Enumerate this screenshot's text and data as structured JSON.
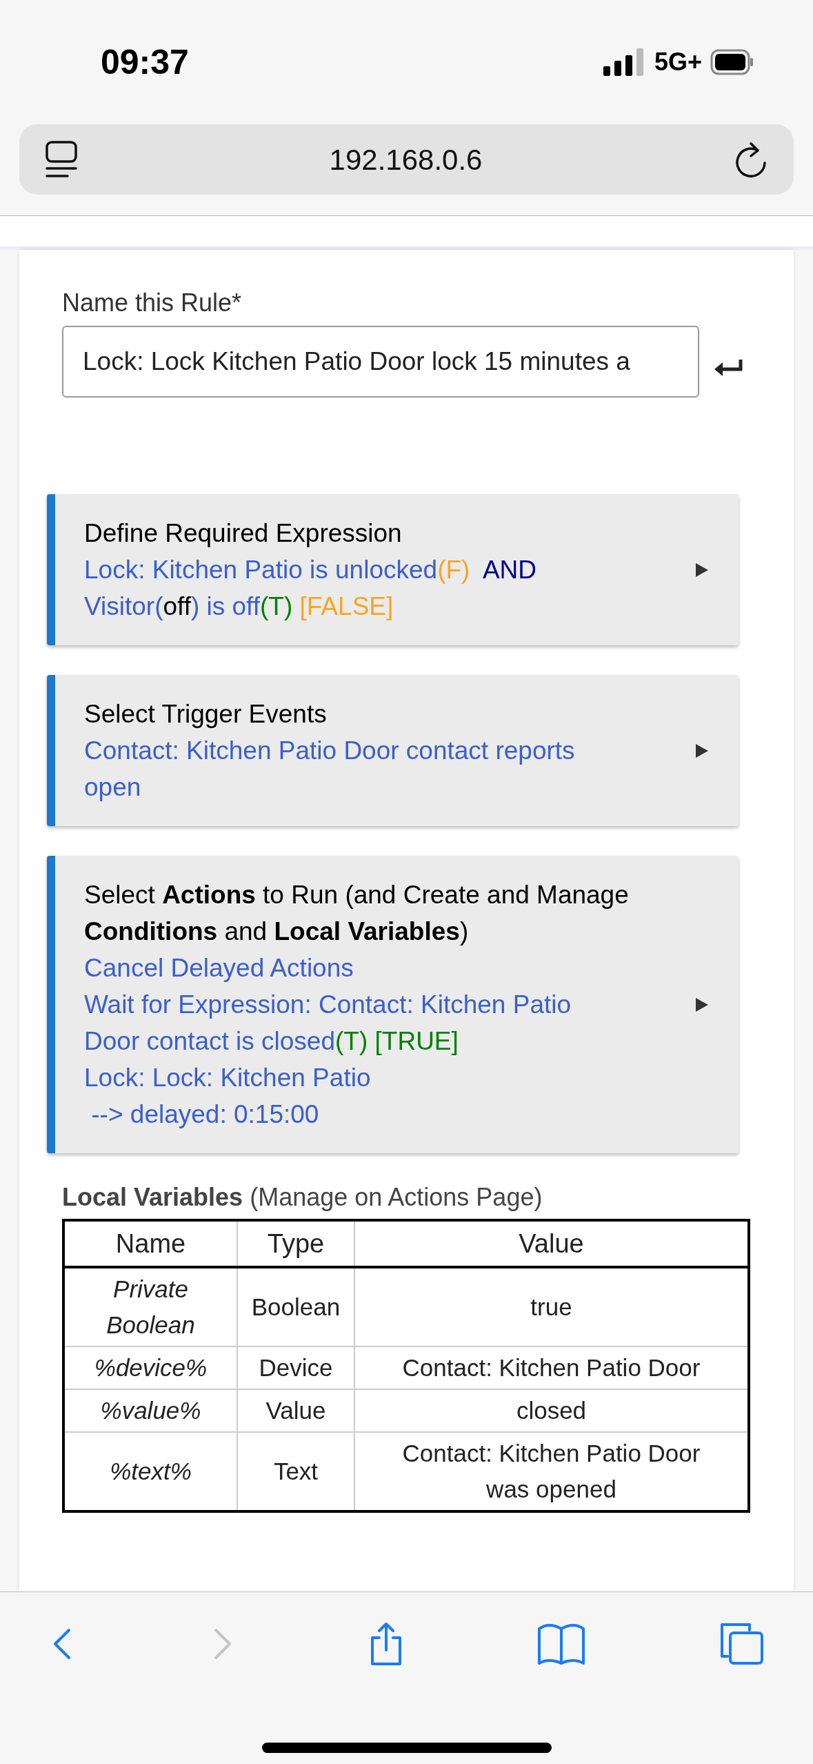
{
  "status_bar": {
    "time": "09:37",
    "network": "5G+"
  },
  "address_bar": {
    "url": "192.168.0.6"
  },
  "rule_name": {
    "label": "Name this Rule*",
    "value": "Lock: Lock Kitchen Patio Door lock 15 minutes a"
  },
  "sections": [
    {
      "title": "Define Required Expression",
      "lines": [
        [
          {
            "text": "Lock: Kitchen Patio is unlocked",
            "color": "#3a5fcd"
          },
          {
            "text": "(F)",
            "color": "#f5a623"
          },
          {
            "text": "  AND",
            "color": "#00008b"
          }
        ],
        [
          {
            "text": "Visitor(",
            "color": "#3a5fcd"
          },
          {
            "text": "off",
            "color": "#000000"
          },
          {
            "text": ") is off",
            "color": "#3a5fcd"
          },
          {
            "text": "(T)",
            "color": "#008000"
          },
          {
            "text": " [FALSE]",
            "color": "#f5a623"
          }
        ]
      ]
    },
    {
      "title": "Select Trigger Events",
      "lines": [
        [
          {
            "text": "Contact: Kitchen Patio Door contact reports",
            "color": "#3a5fcd"
          }
        ],
        [
          {
            "text": "open",
            "color": "#3a5fcd"
          }
        ]
      ]
    },
    {
      "title": "Select **Actions** to Run (and Create and Manage **Conditions** and **Local Variables**)",
      "lines": [
        [
          {
            "text": "Cancel Delayed Actions",
            "color": "#3a5fcd"
          }
        ],
        [
          {
            "text": "Wait for Expression: Contact: Kitchen Patio",
            "color": "#3a5fcd"
          }
        ],
        [
          {
            "text": "Door contact is closed",
            "color": "#3a5fcd"
          },
          {
            "text": "(T) [TRUE]",
            "color": "#008000"
          }
        ],
        [
          {
            "text": "Lock: Lock: Kitchen Patio",
            "color": "#3a5fcd"
          }
        ],
        [
          {
            "text": " --> delayed: 0:15:00",
            "color": "#3a5fcd"
          }
        ]
      ]
    }
  ],
  "local_variables": {
    "title": "**Local Variables** (Manage on Actions Page)",
    "columns": [
      "Name",
      "Type",
      "Value"
    ],
    "rows": [
      [
        "Private Boolean",
        "Boolean",
        "true"
      ],
      [
        "%device%",
        "Device",
        "Contact: Kitchen Patio Door"
      ],
      [
        "%value%",
        "Value",
        "closed"
      ],
      [
        "%text%",
        "Text",
        "Contact: Kitchen Patio Door was opened"
      ]
    ]
  },
  "toolbar": [
    {
      "kind": "back",
      "disabled": false
    },
    {
      "kind": "forward",
      "disabled": true
    },
    {
      "kind": "share",
      "disabled": false
    },
    {
      "kind": "bookmarks",
      "disabled": false
    },
    {
      "kind": "tabs",
      "disabled": false
    }
  ]
}
